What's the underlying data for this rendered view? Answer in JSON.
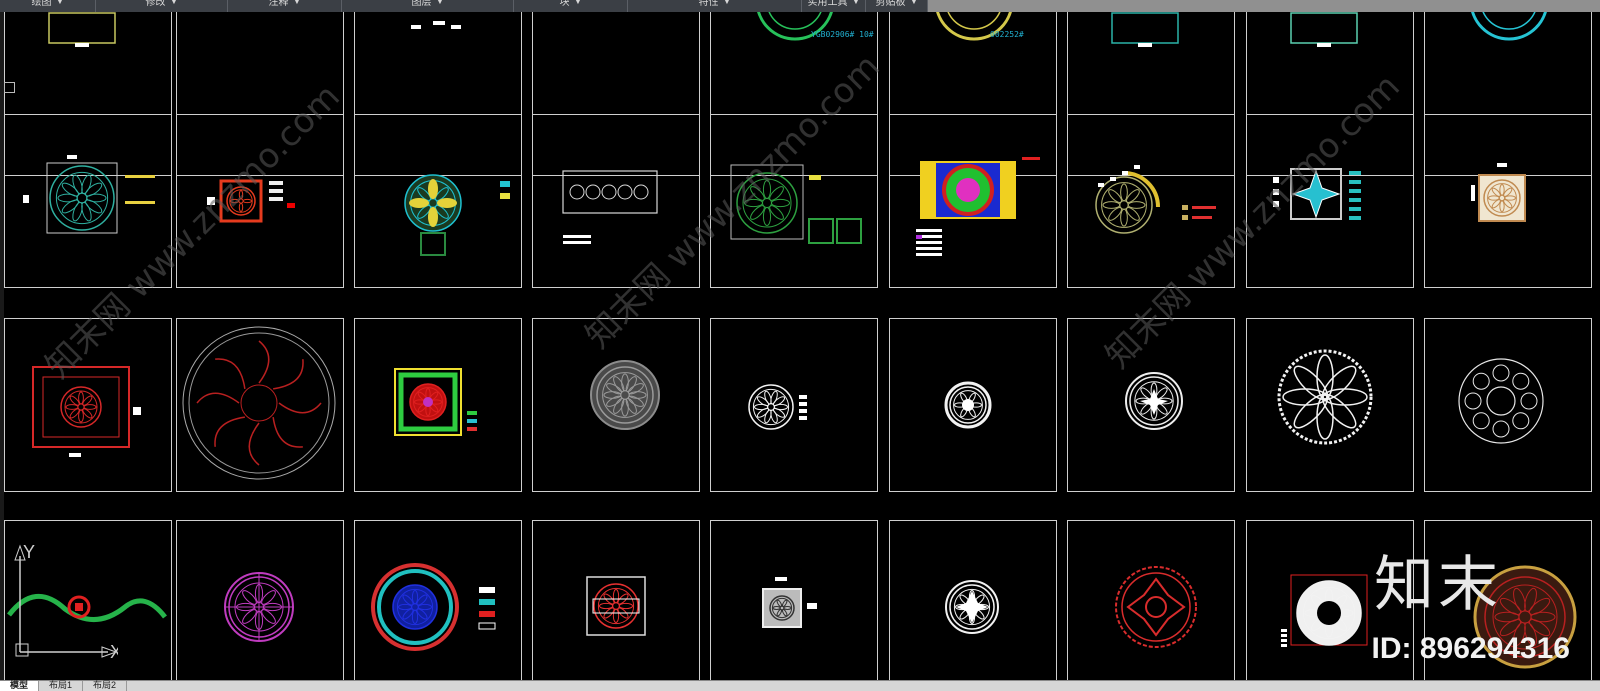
{
  "ribbon": {
    "panels": [
      {
        "label": "绘图",
        "width": 96
      },
      {
        "label": "修改",
        "width": 132
      },
      {
        "label": "注释",
        "width": 114
      },
      {
        "label": "图层",
        "width": 172
      },
      {
        "label": "块",
        "width": 114
      },
      {
        "label": "特性",
        "width": 174
      },
      {
        "label": "实用工具",
        "width": 64
      },
      {
        "label": "剪贴板",
        "width": 62
      }
    ]
  },
  "watermark": {
    "text": "知末网 www.znzmo.com",
    "color": "#5a5a5a"
  },
  "grid": {
    "row_count": 4,
    "col_count": 9,
    "cells": [
      {
        "motif": "square-partial",
        "color": "#c8c860"
      },
      {
        "motif": "blank"
      },
      {
        "motif": "labels",
        "color": "#ffffff"
      },
      {
        "motif": "blank"
      },
      {
        "motif": "medallion-partial",
        "color": "#27c15a",
        "label": "YGB02906# 10#"
      },
      {
        "motif": "medallion-partial",
        "color": "#d4c84a",
        "label": "002252#"
      },
      {
        "motif": "square-partial",
        "color": "#2ab3a8"
      },
      {
        "motif": "square-partial",
        "color": "#5ad0b0"
      },
      {
        "motif": "medallion-partial",
        "color": "#26c4d4"
      },
      {
        "motif": "circle-in-square",
        "color": "#2fb0a0"
      },
      {
        "motif": "square-knot",
        "color": "#e63b1e"
      },
      {
        "motif": "floral-medallion",
        "color": "#e4d23a"
      },
      {
        "motif": "rect-pattern",
        "color": "#d8d8d8"
      },
      {
        "motif": "circle-panels",
        "color": "#2da040"
      },
      {
        "motif": "rect-color",
        "color": "#f0d020"
      },
      {
        "motif": "medallion-gray",
        "color": "#b0b070"
      },
      {
        "motif": "star-square",
        "color": "#27c0d0"
      },
      {
        "motif": "cream-square",
        "color": "#d8b890"
      },
      {
        "motif": "red-square",
        "color": "#d62828"
      },
      {
        "motif": "big-circle-red",
        "color": "#b82020"
      },
      {
        "motif": "green-red-square",
        "color": "#2ecc40"
      },
      {
        "motif": "gray-rosette",
        "color": "#8c8c8c"
      },
      {
        "motif": "white-rosette",
        "color": "#f2f2f2"
      },
      {
        "motif": "white-ring",
        "color": "#f2f2f2"
      },
      {
        "motif": "white-ornate",
        "color": "#eeeeee"
      },
      {
        "motif": "white-lotus",
        "color": "#f2f2f2"
      },
      {
        "motif": "white-thin-ring",
        "color": "#e6e6e6"
      },
      {
        "motif": "border-strip",
        "color": "#26b34a"
      },
      {
        "motif": "magenta-circle",
        "color": "#c03cc0"
      },
      {
        "motif": "blue-ring",
        "color": "#d63030"
      },
      {
        "motif": "red-white-square",
        "color": "#e63030"
      },
      {
        "motif": "small-gray-square",
        "color": "#d8d8d8"
      },
      {
        "motif": "white-circle",
        "color": "#f2f2f2"
      },
      {
        "motif": "red-circle",
        "color": "#d82c2c"
      },
      {
        "motif": "white-red-square",
        "color": "#f2f2f2"
      },
      {
        "motif": "gold-ring",
        "color": "#c8a040"
      }
    ]
  },
  "ucs": {
    "y_label": "Y",
    "x_label": "X"
  },
  "bottom_tabs": [
    "模型",
    "布局1",
    "布局2"
  ],
  "brand": {
    "logo_text": "知末",
    "id_text": "ID: 896294316"
  }
}
